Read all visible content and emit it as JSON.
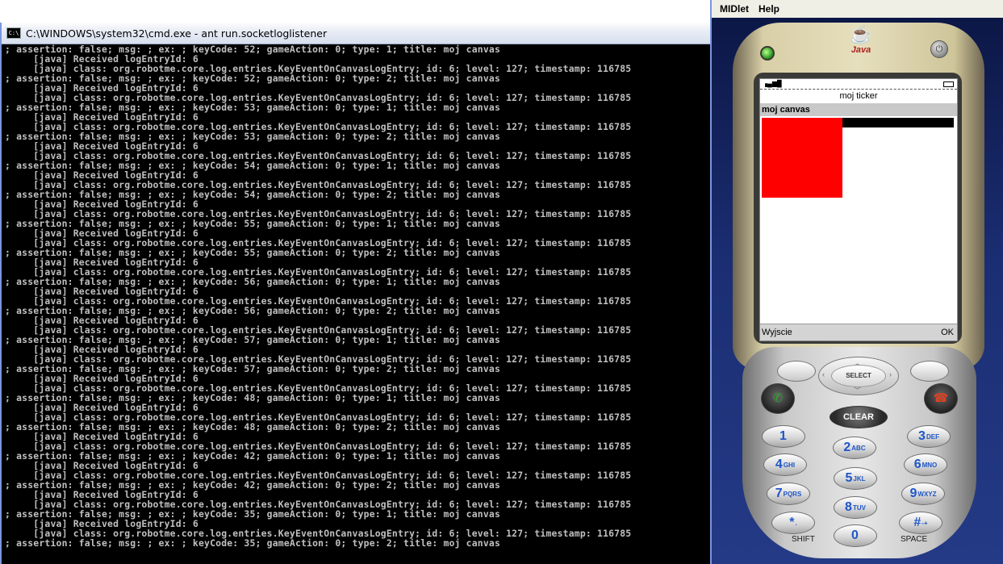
{
  "cmd": {
    "title": "C:\\WINDOWS\\system32\\cmd.exe - ant run.socketloglistener",
    "icon": "C:\\",
    "lines": [
      "; assertion: false; msg: ; ex: ; keyCode: 52; gameAction: 0; type: 1; title: moj canvas",
      "     [java] Received logEntryId: 6",
      "     [java] class: org.robotme.core.log.entries.KeyEventOnCanvasLogEntry; id: 6; level: 127; timestamp: 116785",
      "; assertion: false; msg: ; ex: ; keyCode: 52; gameAction: 0; type: 2; title: moj canvas",
      "     [java] Received logEntryId: 6",
      "     [java] class: org.robotme.core.log.entries.KeyEventOnCanvasLogEntry; id: 6; level: 127; timestamp: 116785",
      "; assertion: false; msg: ; ex: ; keyCode: 53; gameAction: 0; type: 1; title: moj canvas",
      "     [java] Received logEntryId: 6",
      "     [java] class: org.robotme.core.log.entries.KeyEventOnCanvasLogEntry; id: 6; level: 127; timestamp: 116785",
      "; assertion: false; msg: ; ex: ; keyCode: 53; gameAction: 0; type: 2; title: moj canvas",
      "     [java] Received logEntryId: 6",
      "     [java] class: org.robotme.core.log.entries.KeyEventOnCanvasLogEntry; id: 6; level: 127; timestamp: 116785",
      "; assertion: false; msg: ; ex: ; keyCode: 54; gameAction: 0; type: 1; title: moj canvas",
      "     [java] Received logEntryId: 6",
      "     [java] class: org.robotme.core.log.entries.KeyEventOnCanvasLogEntry; id: 6; level: 127; timestamp: 116785",
      "; assertion: false; msg: ; ex: ; keyCode: 54; gameAction: 0; type: 2; title: moj canvas",
      "     [java] Received logEntryId: 6",
      "     [java] class: org.robotme.core.log.entries.KeyEventOnCanvasLogEntry; id: 6; level: 127; timestamp: 116785",
      "; assertion: false; msg: ; ex: ; keyCode: 55; gameAction: 0; type: 1; title: moj canvas",
      "     [java] Received logEntryId: 6",
      "     [java] class: org.robotme.core.log.entries.KeyEventOnCanvasLogEntry; id: 6; level: 127; timestamp: 116785",
      "; assertion: false; msg: ; ex: ; keyCode: 55; gameAction: 0; type: 2; title: moj canvas",
      "     [java] Received logEntryId: 6",
      "     [java] class: org.robotme.core.log.entries.KeyEventOnCanvasLogEntry; id: 6; level: 127; timestamp: 116785",
      "; assertion: false; msg: ; ex: ; keyCode: 56; gameAction: 0; type: 1; title: moj canvas",
      "     [java] Received logEntryId: 6",
      "     [java] class: org.robotme.core.log.entries.KeyEventOnCanvasLogEntry; id: 6; level: 127; timestamp: 116785",
      "; assertion: false; msg: ; ex: ; keyCode: 56; gameAction: 0; type: 2; title: moj canvas",
      "     [java] Received logEntryId: 6",
      "     [java] class: org.robotme.core.log.entries.KeyEventOnCanvasLogEntry; id: 6; level: 127; timestamp: 116785",
      "; assertion: false; msg: ; ex: ; keyCode: 57; gameAction: 0; type: 1; title: moj canvas",
      "     [java] Received logEntryId: 6",
      "     [java] class: org.robotme.core.log.entries.KeyEventOnCanvasLogEntry; id: 6; level: 127; timestamp: 116785",
      "; assertion: false; msg: ; ex: ; keyCode: 57; gameAction: 0; type: 2; title: moj canvas",
      "     [java] Received logEntryId: 6",
      "     [java] class: org.robotme.core.log.entries.KeyEventOnCanvasLogEntry; id: 6; level: 127; timestamp: 116785",
      "; assertion: false; msg: ; ex: ; keyCode: 48; gameAction: 0; type: 1; title: moj canvas",
      "     [java] Received logEntryId: 6",
      "     [java] class: org.robotme.core.log.entries.KeyEventOnCanvasLogEntry; id: 6; level: 127; timestamp: 116785",
      "; assertion: false; msg: ; ex: ; keyCode: 48; gameAction: 0; type: 2; title: moj canvas",
      "     [java] Received logEntryId: 6",
      "     [java] class: org.robotme.core.log.entries.KeyEventOnCanvasLogEntry; id: 6; level: 127; timestamp: 116785",
      "; assertion: false; msg: ; ex: ; keyCode: 42; gameAction: 0; type: 1; title: moj canvas",
      "     [java] Received logEntryId: 6",
      "     [java] class: org.robotme.core.log.entries.KeyEventOnCanvasLogEntry; id: 6; level: 127; timestamp: 116785",
      "; assertion: false; msg: ; ex: ; keyCode: 42; gameAction: 0; type: 2; title: moj canvas",
      "     [java] Received logEntryId: 6",
      "     [java] class: org.robotme.core.log.entries.KeyEventOnCanvasLogEntry; id: 6; level: 127; timestamp: 116785",
      "; assertion: false; msg: ; ex: ; keyCode: 35; gameAction: 0; type: 1; title: moj canvas",
      "     [java] Received logEntryId: 6",
      "     [java] class: org.robotme.core.log.entries.KeyEventOnCanvasLogEntry; id: 6; level: 127; timestamp: 116785",
      "; assertion: false; msg: ; ex: ; keyCode: 35; gameAction: 0; type: 2; title: moj canvas"
    ]
  },
  "emulator": {
    "menu": [
      "MIDlet",
      "Help"
    ],
    "java_logo": {
      "icon": "java-cup-icon",
      "text": "Java"
    },
    "screen": {
      "ticker": "moj ticker",
      "canvas_title": "moj canvas",
      "soft_left": "Wyjscie",
      "soft_right": "OK",
      "signal_icon": "signal-icon",
      "battery_icon": "battery-icon"
    },
    "buttons": {
      "select": "SELECT",
      "clear": "CLEAR",
      "send_icon": "phone-call-icon",
      "end_icon": "phone-hangup-icon"
    },
    "keypad": [
      {
        "main": "1",
        "sub": ""
      },
      {
        "main": "2",
        "sub": "ABC"
      },
      {
        "main": "3",
        "sub": "DEF"
      },
      {
        "main": "4",
        "sub": "GHI"
      },
      {
        "main": "5",
        "sub": "JKL"
      },
      {
        "main": "6",
        "sub": "MNO"
      },
      {
        "main": "7",
        "sub": "PQRS"
      },
      {
        "main": "8",
        "sub": "TUV"
      },
      {
        "main": "9",
        "sub": "WXYZ"
      },
      {
        "main": "*",
        "sub": "."
      },
      {
        "main": "0",
        "sub": ""
      },
      {
        "main": "#",
        "sub": "-+"
      }
    ],
    "key_under_labels": {
      "shift": "SHIFT",
      "space": "SPACE"
    },
    "colors": {
      "canvas_rect": "#ff0000",
      "key_text": "#1f56c7"
    }
  }
}
